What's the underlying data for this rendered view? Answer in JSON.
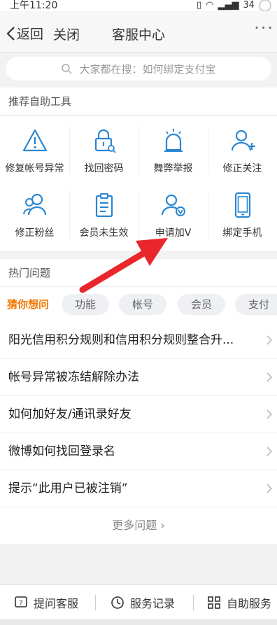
{
  "status_bar": {
    "time": "上午11:20",
    "battery": "34"
  },
  "nav": {
    "back_label": "返回",
    "close_label": "关闭",
    "title": "客服中心",
    "more_label": "···"
  },
  "search": {
    "placeholder": "大家都在搜：如何绑定支付宝"
  },
  "tools_section": {
    "title": "推荐自助工具",
    "items": [
      {
        "label": "修复帐号异常",
        "icon": "warning-icon"
      },
      {
        "label": "找回密码",
        "icon": "lock-icon"
      },
      {
        "label": "舞弊举报",
        "icon": "alarm-icon"
      },
      {
        "label": "修正关注",
        "icon": "user-add-icon"
      },
      {
        "label": "修正粉丝",
        "icon": "users-icon"
      },
      {
        "label": "会员未生效",
        "icon": "clipboard-icon"
      },
      {
        "label": "申请加V",
        "icon": "user-verified-icon"
      },
      {
        "label": "绑定手机",
        "icon": "phone-icon"
      }
    ]
  },
  "hot_section": {
    "title": "热门问题",
    "chips": [
      {
        "label": "猜你想问",
        "active": true
      },
      {
        "label": "功能"
      },
      {
        "label": "帐号"
      },
      {
        "label": "会员"
      },
      {
        "label": "支付"
      }
    ],
    "questions": [
      "阳光信用积分规则和信用积分规则整合升...",
      "帐号异常被冻结解除办法",
      "如何加好友/通讯录好友",
      "微博如何找回登录名",
      "提示“此用户已被注销”"
    ],
    "more_label": "更多问题"
  },
  "bottom_bar": {
    "ask_label": "提问客服",
    "records_label": "服务记录",
    "self_service_label": "自助服务"
  },
  "colors": {
    "accent": "#2a86d1",
    "chip_active": "#f07800",
    "arrow": "#e8262b"
  }
}
